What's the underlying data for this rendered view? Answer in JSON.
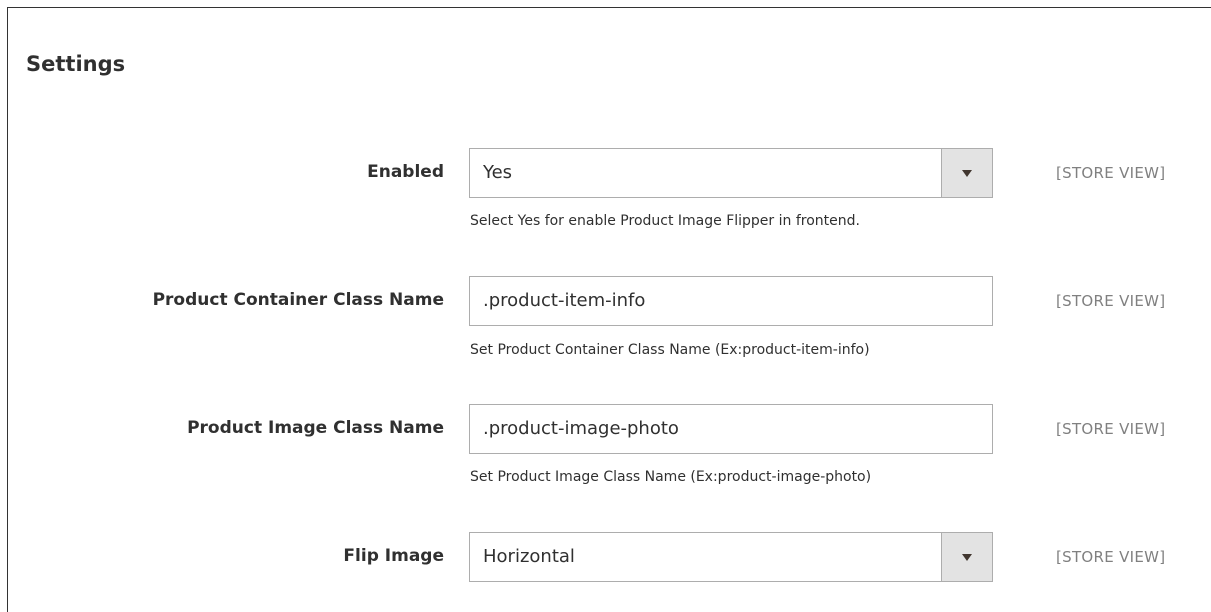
{
  "section": {
    "title": "Settings"
  },
  "fields": [
    {
      "label": "Enabled",
      "type": "select",
      "value": "Yes",
      "note": "Select Yes for enable Product Image Flipper in frontend.",
      "scope": "[STORE VIEW]"
    },
    {
      "label": "Product Container Class Name",
      "type": "text",
      "value": ".product-item-info",
      "note": "Set Product Container Class Name (Ex:product-item-info)",
      "scope": "[STORE VIEW]"
    },
    {
      "label": "Product Image Class Name",
      "type": "text",
      "value": ".product-image-photo",
      "note": "Set Product Image Class Name (Ex:product-image-photo)",
      "scope": "[STORE VIEW]"
    },
    {
      "label": "Flip Image",
      "type": "select",
      "value": "Horizontal",
      "note": "",
      "scope": "[STORE VIEW]"
    }
  ],
  "icons": {
    "select_arrow": "chevron-down-icon"
  },
  "colors": {
    "select_toggle_bg": "#e3e3e3",
    "border": "#adadad",
    "scope_text": "#808080",
    "text": "#303030"
  }
}
